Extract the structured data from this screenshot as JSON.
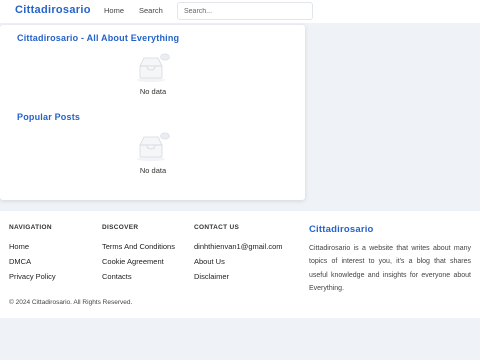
{
  "header": {
    "logo": "Cittadirosario",
    "nav": [
      "Home",
      "Search"
    ],
    "search_placeholder": "Search..."
  },
  "sections": [
    {
      "title": "Cittadirosario - All About Everything",
      "empty_text": "No data"
    },
    {
      "title": "Popular Posts",
      "empty_text": "No data"
    }
  ],
  "footer": {
    "columns": [
      {
        "heading": "NAVIGATION",
        "links": [
          "Home",
          "DMCA",
          "Privacy Policy"
        ]
      },
      {
        "heading": "DISCOVER",
        "links": [
          "Terms And Conditions",
          "Cookie Agreement",
          "Contacts"
        ]
      },
      {
        "heading": "CONTACT US",
        "links": [
          "dinhthienvan1@gmail.com",
          "About Us",
          "Disclaimer"
        ]
      }
    ],
    "brand_title": "Cittadirosario",
    "brand_description": "Cittadirosario is a website that writes about many topics of interest to you, it's a blog that shares useful knowledge and insights for everyone about Everything.",
    "copyright": "© 2024 Cittadirosario. All Rights Reserved."
  },
  "colors": {
    "accent": "#2563c9",
    "background": "#eff2f7"
  },
  "icons": [
    "empty-inbox-icon"
  ]
}
